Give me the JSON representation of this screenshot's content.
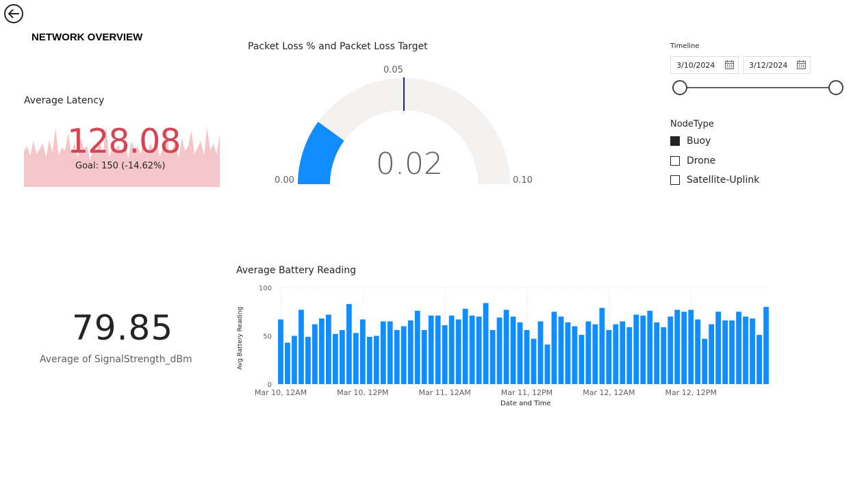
{
  "page": {
    "title": "NETWORK OVERVIEW",
    "back_icon": "back-arrow-circle-icon"
  },
  "latency_card": {
    "title": "Average Latency",
    "value": "128.08",
    "alert_glyph": "!",
    "goal_text": "Goal: 150 (-14.62%)",
    "value_color": "#d64554",
    "sparkline_color": "#f4c6c9",
    "sparkline_values": [
      0.55,
      0.62,
      0.48,
      0.7,
      0.5,
      0.58,
      0.66,
      0.45,
      0.72,
      0.52,
      0.9,
      0.48,
      0.6,
      0.55,
      0.82,
      0.5,
      0.68,
      0.44,
      0.74,
      0.58,
      0.62,
      0.4,
      0.66,
      0.56,
      0.7,
      0.5,
      0.92,
      0.46,
      0.6,
      0.58,
      0.64,
      0.5,
      0.78,
      0.42,
      0.7,
      0.56,
      0.62,
      0.5,
      0.85,
      0.48,
      0.66,
      0.55,
      0.72,
      0.46,
      0.6,
      0.95,
      0.5,
      0.58,
      0.68,
      0.44,
      0.74,
      0.55,
      0.62,
      0.86,
      0.5,
      0.6,
      0.7,
      0.48,
      0.9,
      0.56,
      0.66,
      0.5,
      0.8
    ]
  },
  "gauge": {
    "title": "Packet Loss % and Packet Loss Target",
    "value": 0.02,
    "value_label": "0.02",
    "min": 0,
    "max": 0.1,
    "min_label": "0.00",
    "max_label": "0.10",
    "target": 0.05,
    "target_label": "0.05",
    "fill_color": "#118dff",
    "track_color": "#f3f2f1",
    "target_color": "#12239e"
  },
  "timeline_slicer": {
    "label": "Timeline",
    "start_date": "3/10/2024",
    "end_date": "3/12/2024",
    "calendar_icon": "calendar-icon"
  },
  "nodetype_slicer": {
    "title": "NodeType",
    "items": [
      {
        "label": "Buoy",
        "checked": true
      },
      {
        "label": "Drone",
        "checked": false
      },
      {
        "label": "Satellite-Uplink",
        "checked": false
      }
    ]
  },
  "signal_card": {
    "value": "79.85",
    "label": "Average of SignalStrength_dBm"
  },
  "chart_data": {
    "type": "bar",
    "title": "Average Battery Reading",
    "xlabel": "Date and Time",
    "ylabel": "Avg Battery Reading",
    "ylim": [
      0,
      100
    ],
    "y_ticks": [
      "0",
      "50",
      "100"
    ],
    "x_tick_labels": [
      "Mar 10, 12AM",
      "Mar 10, 12PM",
      "Mar 11, 12AM",
      "Mar 11, 12PM",
      "Mar 12, 12AM",
      "Mar 12, 12PM"
    ],
    "bar_color": "#118dff",
    "grid": true,
    "values": [
      67,
      43,
      50,
      77,
      49,
      62,
      68,
      72,
      52,
      56,
      83,
      53,
      67,
      49,
      50,
      65,
      65,
      56,
      60,
      66,
      76,
      56,
      71,
      71,
      61,
      71,
      67,
      78,
      71,
      70,
      84,
      56,
      69,
      77,
      70,
      64,
      56,
      47,
      65,
      41,
      75,
      70,
      64,
      60,
      51,
      65,
      62,
      79,
      56,
      62,
      65,
      59,
      72,
      71,
      76,
      64,
      59,
      70,
      77,
      75,
      77,
      67,
      47,
      62,
      75,
      66,
      66,
      75,
      70,
      68,
      51,
      80
    ]
  }
}
